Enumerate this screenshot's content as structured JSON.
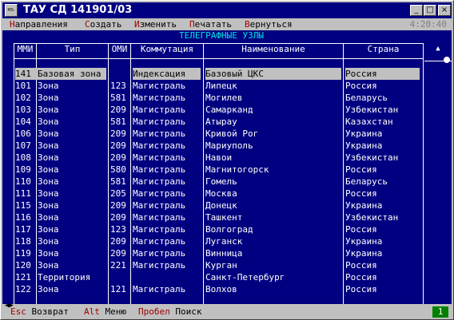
{
  "window": {
    "title": "ТАУ СД 141901/03",
    "app_icon": "MS-DOS",
    "buttons": {
      "minimize": "_",
      "maximize": "□",
      "close": "×"
    }
  },
  "menu": {
    "items": [
      {
        "key": "Н",
        "rest": "аправления"
      },
      {
        "key": "С",
        "rest": "оздать"
      },
      {
        "key": "И",
        "rest": "зменить"
      },
      {
        "key": "П",
        "rest": "ечатать"
      },
      {
        "key": "В",
        "rest": "ернуться"
      }
    ],
    "clock": "4:20:40"
  },
  "screen": {
    "heading": "ТЕЛЕГРАФНЫЕ УЗЛЫ",
    "columns": {
      "mmi": "ММИ",
      "type": "Тип",
      "omi": "ОМИ",
      "comm": "Коммутация",
      "name": "Наименование",
      "country": "Страна"
    },
    "rows": [
      {
        "mmi": "141",
        "type": "Базовая зона",
        "omi": "",
        "comm": "Индексация",
        "name": "Базовый ЦКС",
        "country": "Россия",
        "selected": true
      },
      {
        "mmi": "101",
        "type": "Зона",
        "omi": "123",
        "comm": "Магистраль",
        "name": "Липецк",
        "country": "Россия"
      },
      {
        "mmi": "102",
        "type": "Зона",
        "omi": "581",
        "comm": "Магистраль",
        "name": "Могилев",
        "country": "Беларусь"
      },
      {
        "mmi": "103",
        "type": "Зона",
        "omi": "209",
        "comm": "Магистраль",
        "name": "Самарканд",
        "country": "Узбекистан"
      },
      {
        "mmi": "104",
        "type": "Зона",
        "omi": "581",
        "comm": "Магистраль",
        "name": "Атырау",
        "country": "Казахстан"
      },
      {
        "mmi": "106",
        "type": "Зона",
        "omi": "209",
        "comm": "Магистраль",
        "name": "Кривой Рог",
        "country": "Украина"
      },
      {
        "mmi": "107",
        "type": "Зона",
        "omi": "209",
        "comm": "Магистраль",
        "name": "Мариуполь",
        "country": "Украина"
      },
      {
        "mmi": "108",
        "type": "Зона",
        "omi": "209",
        "comm": "Магистраль",
        "name": "Навои",
        "country": "Узбекистан"
      },
      {
        "mmi": "109",
        "type": "Зона",
        "omi": "580",
        "comm": "Магистраль",
        "name": "Магнитогорск",
        "country": "Россия"
      },
      {
        "mmi": "110",
        "type": "Зона",
        "omi": "581",
        "comm": "Магистраль",
        "name": "Гомель",
        "country": "Беларусь"
      },
      {
        "mmi": "111",
        "type": "Зона",
        "omi": "205",
        "comm": "Магистраль",
        "name": "Москва",
        "country": "Россия"
      },
      {
        "mmi": "115",
        "type": "Зона",
        "omi": "209",
        "comm": "Магистраль",
        "name": "Донецк",
        "country": "Украина"
      },
      {
        "mmi": "116",
        "type": "Зона",
        "omi": "209",
        "comm": "Магистраль",
        "name": "Ташкент",
        "country": "Узбекистан"
      },
      {
        "mmi": "117",
        "type": "Зона",
        "omi": "123",
        "comm": "Магистраль",
        "name": "Волгоград",
        "country": "Россия"
      },
      {
        "mmi": "118",
        "type": "Зона",
        "omi": "209",
        "comm": "Магистраль",
        "name": "Луганск",
        "country": "Украина"
      },
      {
        "mmi": "119",
        "type": "Зона",
        "omi": "209",
        "comm": "Магистраль",
        "name": "Винница",
        "country": "Украина"
      },
      {
        "mmi": "120",
        "type": "Зона",
        "omi": "221",
        "comm": "Магистраль",
        "name": "Курган",
        "country": "Россия"
      },
      {
        "mmi": "121",
        "type": "Территория",
        "omi": "",
        "comm": "",
        "name": "Санкт-Петербург",
        "country": "Россия"
      },
      {
        "mmi": "122",
        "type": "Зона",
        "omi": "121",
        "comm": "Магистраль",
        "name": "Волхов",
        "country": "Россия"
      }
    ]
  },
  "status": {
    "esc_key": "Esc",
    "esc_label": "Возврат",
    "alt_key": "Alt",
    "alt_label": "Меню",
    "space_key": "Пробел",
    "space_label": "Поиск",
    "page": "1"
  },
  "colors": {
    "screen_bg": "#000080",
    "text": "#ffffff",
    "heading": "#00e0e0",
    "hotkey": "#a00000",
    "page_badge": "#008000"
  }
}
